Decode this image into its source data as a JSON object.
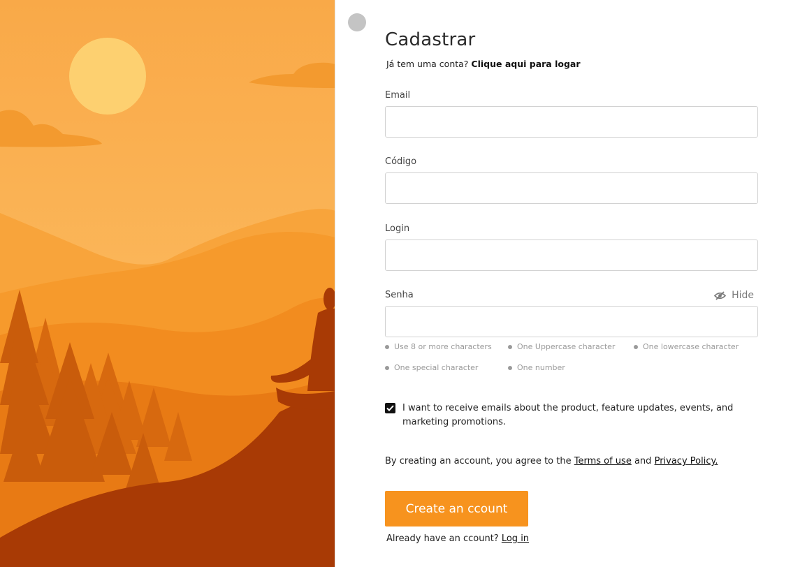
{
  "page": {
    "title": "Cadastrar",
    "subtitle_prefix": "Já tem uma conta?",
    "subtitle_link": "Clique aqui para logar"
  },
  "fields": {
    "email": {
      "label": "Email",
      "value": "",
      "placeholder": ""
    },
    "code": {
      "label": "Código",
      "value": "",
      "placeholder": ""
    },
    "login": {
      "label": "Login",
      "value": "",
      "placeholder": ""
    },
    "password": {
      "label": "Senha",
      "value": "",
      "placeholder": "",
      "toggle_label": "Hide"
    }
  },
  "password_rules": [
    "Use 8 or more characters",
    "One Uppercase character",
    "One lowercase character",
    "One special character",
    "One number"
  ],
  "consent": {
    "checked": true,
    "text": "I want to receive emails about the product, feature updates, events, and marketing promotions."
  },
  "agreement": {
    "prefix": "By creating an account, you agree to the",
    "terms_link": "Terms of use",
    "conjunction": "and",
    "privacy_link": "Privacy Policy."
  },
  "cta": {
    "label": "Create an ccount"
  },
  "footer": {
    "prefix": "Already have an ccount?",
    "link": "Log in"
  },
  "icons": {
    "password_toggle": "eye-slash-icon",
    "avatar": "placeholder-dot"
  },
  "colors": {
    "accent": "#f7931e",
    "text": "#222222",
    "muted": "#9a9a9a",
    "border": "#d2d2d2"
  }
}
